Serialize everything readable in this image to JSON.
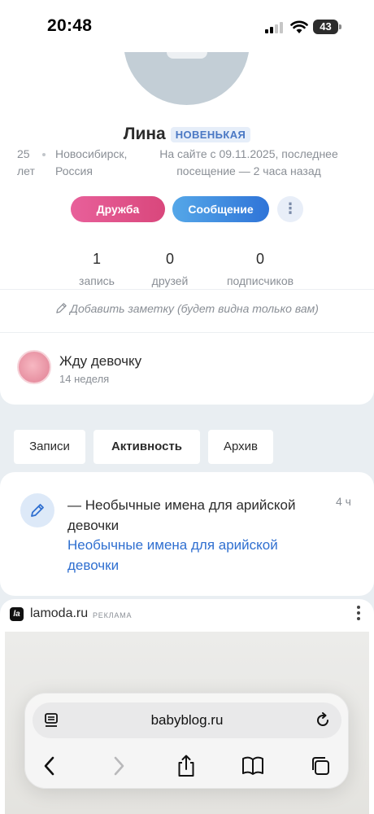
{
  "status_bar": {
    "time": "20:48",
    "battery": "43"
  },
  "profile": {
    "name": "Лина",
    "badge": "НОВЕНЬКАЯ",
    "age_line1": "25",
    "age_line2": "лет",
    "city_line1": "Новосибирск,",
    "city_line2": "Россия",
    "visit_line1": "На сайте с 09.11.2025, последнее",
    "visit_line2": "посещение — 2 часа назад",
    "friend_button": "Дружба",
    "message_button": "Сообщение",
    "more_button": "⋮"
  },
  "stats": [
    {
      "value": "1",
      "label": "запись"
    },
    {
      "value": "0",
      "label": "друзей"
    },
    {
      "value": "0",
      "label": "подписчиков"
    }
  ],
  "note": "Добавить заметку (будет видна только вам)",
  "pregnancy": {
    "title": "Жду девочку",
    "week": "14 неделя"
  },
  "tabs": [
    "Записи",
    "Активность",
    "Архив"
  ],
  "activity": {
    "text": "— Необычные имена для арийской девочки",
    "link": "Необычные имена для арийской девочки",
    "time": "4 ч"
  },
  "ad": {
    "logo": "la",
    "domain": "lamoda.ru",
    "tag": "РЕКЛАМА"
  },
  "browser": {
    "url": "babyblog.ru"
  }
}
